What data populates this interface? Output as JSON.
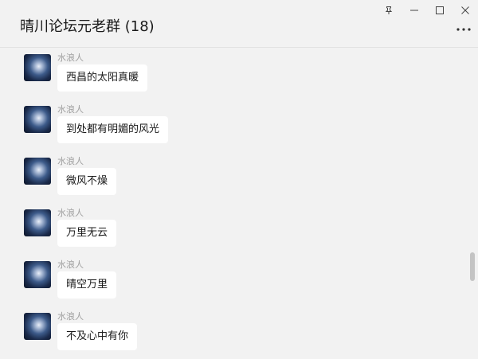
{
  "header": {
    "title": "晴川论坛元老群 (18)",
    "pin_icon": "pin-icon",
    "minimize_icon": "minimize-icon",
    "maximize_icon": "maximize-icon",
    "close_icon": "close-icon",
    "more_icon": "more-options-icon"
  },
  "messages": [
    {
      "sender": "水浪人",
      "text": "西昌的太阳真暖"
    },
    {
      "sender": "水浪人",
      "text": "到处都有明媚的风光"
    },
    {
      "sender": "水浪人",
      "text": "微风不燥"
    },
    {
      "sender": "水浪人",
      "text": "万里无云"
    },
    {
      "sender": "水浪人",
      "text": "晴空万里"
    },
    {
      "sender": "水浪人",
      "text": "不及心中有你"
    }
  ],
  "colors": {
    "background": "#f2f2f2",
    "bubble": "#ffffff",
    "sender_name": "#a0a0a0",
    "text": "#1a1a1a"
  }
}
